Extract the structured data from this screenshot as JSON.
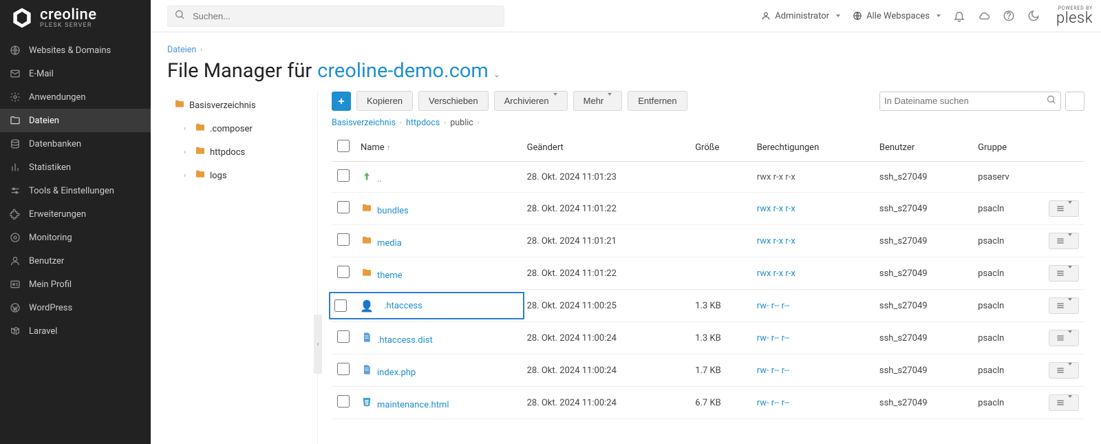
{
  "sidebar": {
    "brand": "creoline",
    "brand_subtitle": "PLESK SERVER",
    "items": [
      {
        "label": "Websites & Domains",
        "icon": "globe"
      },
      {
        "label": "E-Mail",
        "icon": "mail"
      },
      {
        "label": "Anwendungen",
        "icon": "gear"
      },
      {
        "label": "Dateien",
        "icon": "folder",
        "active": true
      },
      {
        "label": "Datenbanken",
        "icon": "database"
      },
      {
        "label": "Statistiken",
        "icon": "stats"
      },
      {
        "label": "Tools & Einstellungen",
        "icon": "sliders"
      },
      {
        "label": "Erweiterungen",
        "icon": "puzzle"
      },
      {
        "label": "Monitoring",
        "icon": "monitor"
      },
      {
        "label": "Benutzer",
        "icon": "user"
      },
      {
        "label": "Mein Profil",
        "icon": "card"
      },
      {
        "label": "WordPress",
        "icon": "wordpress"
      },
      {
        "label": "Laravel",
        "icon": "laravel"
      }
    ]
  },
  "topbar": {
    "search_placeholder": "Suchen...",
    "admin_label": "Administrator",
    "webspace_label": "Alle Webspaces",
    "powered_by": "POWERED BY",
    "plesk": "plesk"
  },
  "page": {
    "breadcrumb_root": "Dateien",
    "title_prefix": "File Manager für ",
    "title_domain": "creoline-demo.com"
  },
  "tree": {
    "root": "Basisverzeichnis",
    "children": [
      {
        "label": ".composer"
      },
      {
        "label": "httpdocs"
      },
      {
        "label": "logs"
      }
    ]
  },
  "toolbar": {
    "copy": "Kopieren",
    "move": "Verschieben",
    "archive": "Archivieren",
    "more": "Mehr",
    "remove": "Entfernen",
    "search_placeholder": "In Dateiname suchen"
  },
  "path": [
    {
      "label": "Basisverzeichnis",
      "link": true
    },
    {
      "label": "httpdocs",
      "link": true
    },
    {
      "label": "public",
      "link": false
    }
  ],
  "table": {
    "headers": {
      "name": "Name",
      "modified": "Geändert",
      "size": "Größe",
      "perms": "Berechtigungen",
      "user": "Benutzer",
      "group": "Gruppe"
    },
    "rows": [
      {
        "name": "..",
        "icon": "up",
        "modified": "28. Okt. 2024 11:01:23",
        "size": "",
        "perms": "rwx r-x r-x",
        "perm_link": false,
        "user": "ssh_s27049",
        "group": "psaserv",
        "menu": false,
        "highlighted": false
      },
      {
        "name": "bundles",
        "icon": "folder",
        "modified": "28. Okt. 2024 11:01:22",
        "size": "",
        "perms": "rwx r-x r-x",
        "perm_link": true,
        "user": "ssh_s27049",
        "group": "psacln",
        "menu": true,
        "highlighted": false
      },
      {
        "name": "media",
        "icon": "folder",
        "modified": "28. Okt. 2024 11:01:21",
        "size": "",
        "perms": "rwx r-x r-x",
        "perm_link": true,
        "user": "ssh_s27049",
        "group": "psacln",
        "menu": true,
        "highlighted": false
      },
      {
        "name": "theme",
        "icon": "folder",
        "modified": "28. Okt. 2024 11:01:22",
        "size": "",
        "perms": "rwx r-x r-x",
        "perm_link": true,
        "user": "ssh_s27049",
        "group": "psacln",
        "menu": true,
        "highlighted": false
      },
      {
        "name": ".htaccess",
        "icon": "user",
        "modified": "28. Okt. 2024 11:00:25",
        "size": "1.3 KB",
        "perms": "rw- r-- r--",
        "perm_link": true,
        "user": "ssh_s27049",
        "group": "psacln",
        "menu": true,
        "highlighted": true
      },
      {
        "name": ".htaccess.dist",
        "icon": "page",
        "modified": "28. Okt. 2024 11:00:24",
        "size": "1.3 KB",
        "perms": "rw- r-- r--",
        "perm_link": true,
        "user": "ssh_s27049",
        "group": "psacln",
        "menu": true,
        "highlighted": false
      },
      {
        "name": "index.php",
        "icon": "page",
        "modified": "28. Okt. 2024 11:00:24",
        "size": "1.7 KB",
        "perms": "rw- r-- r--",
        "perm_link": true,
        "user": "ssh_s27049",
        "group": "psacln",
        "menu": true,
        "highlighted": false
      },
      {
        "name": "maintenance.html",
        "icon": "html",
        "modified": "28. Okt. 2024 11:00:24",
        "size": "6.7 KB",
        "perms": "rw- r-- r--",
        "perm_link": true,
        "user": "ssh_s27049",
        "group": "psacln",
        "menu": true,
        "highlighted": false
      }
    ]
  }
}
